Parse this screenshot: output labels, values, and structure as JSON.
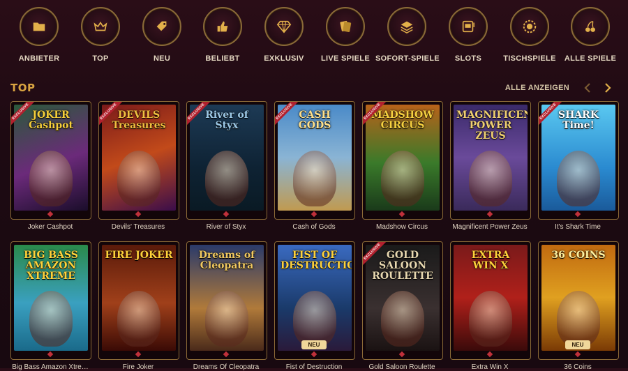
{
  "categories": [
    {
      "label": "ANBIETER",
      "icon": "folder-icon"
    },
    {
      "label": "TOP",
      "icon": "crown-icon"
    },
    {
      "label": "NEU",
      "icon": "tag-icon"
    },
    {
      "label": "BELIEBT",
      "icon": "thumbs-up-icon"
    },
    {
      "label": "EXKLUSIV",
      "icon": "diamond-icon"
    },
    {
      "label": "LIVE SPIELE",
      "icon": "cards-icon"
    },
    {
      "label": "SOFORT-SPIELE",
      "icon": "stack-icon"
    },
    {
      "label": "SLOTS",
      "icon": "slot-machine-icon"
    },
    {
      "label": "TISCHSPIELE",
      "icon": "chip-icon"
    },
    {
      "label": "ALLE SPIELE",
      "icon": "cherries-icon"
    }
  ],
  "section": {
    "title": "TOP",
    "view_all": "ALLE ANZEIGEN"
  },
  "games_row1": [
    {
      "name": "Joker Cashpot",
      "art_title": "JOKER\nCashpot",
      "ribbon": true,
      "badge": ""
    },
    {
      "name": "Devils' Treasures",
      "art_title": "DEVILS\nTreasures",
      "ribbon": true,
      "badge": ""
    },
    {
      "name": "River of Styx",
      "art_title": "River of Styx",
      "ribbon": true,
      "badge": ""
    },
    {
      "name": "Cash of Gods",
      "art_title": "CASH\nGODS",
      "ribbon": true,
      "badge": ""
    },
    {
      "name": "Madshow Circus",
      "art_title": "MADSHOW\nCIRCUS",
      "ribbon": true,
      "badge": ""
    },
    {
      "name": "Magnificent Power Zeus",
      "art_title": "MAGNIFICENT\nPOWER\nZEUS",
      "ribbon": false,
      "badge": ""
    },
    {
      "name": "It's Shark Time",
      "art_title": "SHARK Time!",
      "ribbon": true,
      "badge": ""
    }
  ],
  "games_row2": [
    {
      "name": "Big Bass Amazon Xtre…",
      "art_title": "BIG BASS\nAMAZON\nXTREME",
      "ribbon": false,
      "badge": ""
    },
    {
      "name": "Fire Joker",
      "art_title": "FIRE JOKER",
      "ribbon": false,
      "badge": ""
    },
    {
      "name": "Dreams Of Cleopatra",
      "art_title": "Dreams of Cleopatra",
      "ribbon": false,
      "badge": ""
    },
    {
      "name": "Fist of Destruction",
      "art_title": "FIST OF\nDESTRUCTION",
      "ribbon": false,
      "badge": "NEU"
    },
    {
      "name": "Gold Saloon Roulette",
      "art_title": "GOLD SALOON\nROULETTE",
      "ribbon": true,
      "badge": ""
    },
    {
      "name": "Extra Win X",
      "art_title": "EXTRA\nWIN X",
      "ribbon": false,
      "badge": ""
    },
    {
      "name": "36 Coins",
      "art_title": "36 COINS",
      "ribbon": false,
      "badge": "NEU"
    }
  ],
  "ribbon_text": "EXCLUSIVE",
  "colors": {
    "accent": "#d9a441",
    "card_border": "#8b6a37",
    "ribbon": "#b1202d"
  }
}
